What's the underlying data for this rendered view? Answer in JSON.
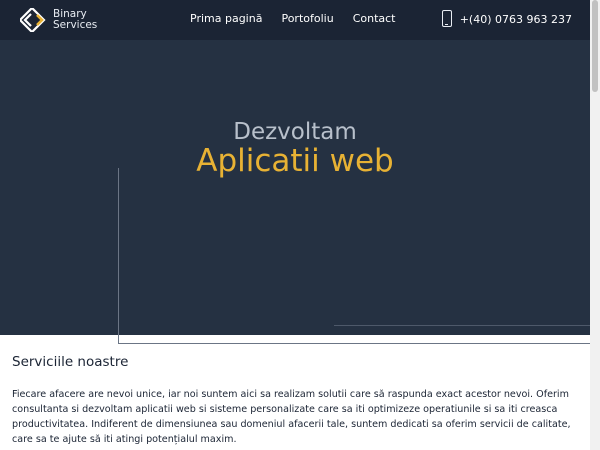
{
  "header": {
    "brand_line1": "Binary",
    "brand_line2": "Services",
    "logo_icon": "binary-services-logo-icon",
    "nav": [
      {
        "label": "Prima pagină"
      },
      {
        "label": "Portofoliu"
      },
      {
        "label": "Contact"
      }
    ],
    "phone_icon": "smartphone-icon",
    "phone": "+(40) 0763 963 237"
  },
  "hero": {
    "line1": "Dezvoltam",
    "line2": "Aplicatii web"
  },
  "services": {
    "title": "Serviciile noastre",
    "body": "Fiecare afacere are nevoi unice, iar noi suntem aici sa realizam solutii care să raspunda exact acestor nevoi. Oferim consultanta si dezvoltam aplicatii web si sisteme personalizate care sa iti optimizeze operatiunile si sa iti creasca productivitatea. Indiferent de dimensiunea sau domeniul afacerii tale, suntem dedicati sa oferim servicii de calitate, care sa te ajute să iti atingi potențialul maxim."
  },
  "colors": {
    "header_bg": "#1b2434",
    "hero_bg": "#253142",
    "accent": "#e8b234",
    "text_dark": "#1b2434"
  }
}
